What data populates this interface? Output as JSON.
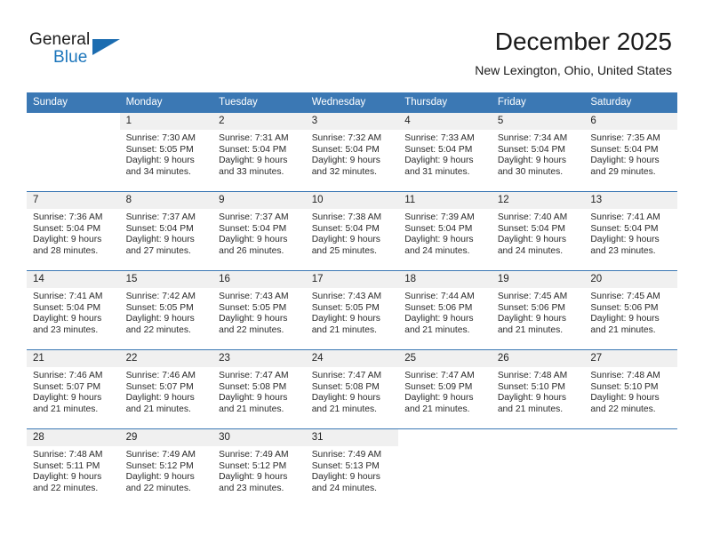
{
  "brand": {
    "word1": "General",
    "word2": "Blue",
    "logo_icon": "blue-triangle-icon",
    "accent_color": "#1b75bb"
  },
  "header": {
    "month_title": "December 2025",
    "location": "New Lexington, Ohio, United States"
  },
  "calendar": {
    "header_bg": "#3b78b4",
    "daynum_bg": "#f0f0f0",
    "weekday_names": [
      "Sunday",
      "Monday",
      "Tuesday",
      "Wednesday",
      "Thursday",
      "Friday",
      "Saturday"
    ],
    "weeks": [
      [
        {
          "day": "",
          "sunrise": "",
          "sunset": "",
          "daylight1": "",
          "daylight2": ""
        },
        {
          "day": "1",
          "sunrise": "Sunrise: 7:30 AM",
          "sunset": "Sunset: 5:05 PM",
          "daylight1": "Daylight: 9 hours",
          "daylight2": "and 34 minutes."
        },
        {
          "day": "2",
          "sunrise": "Sunrise: 7:31 AM",
          "sunset": "Sunset: 5:04 PM",
          "daylight1": "Daylight: 9 hours",
          "daylight2": "and 33 minutes."
        },
        {
          "day": "3",
          "sunrise": "Sunrise: 7:32 AM",
          "sunset": "Sunset: 5:04 PM",
          "daylight1": "Daylight: 9 hours",
          "daylight2": "and 32 minutes."
        },
        {
          "day": "4",
          "sunrise": "Sunrise: 7:33 AM",
          "sunset": "Sunset: 5:04 PM",
          "daylight1": "Daylight: 9 hours",
          "daylight2": "and 31 minutes."
        },
        {
          "day": "5",
          "sunrise": "Sunrise: 7:34 AM",
          "sunset": "Sunset: 5:04 PM",
          "daylight1": "Daylight: 9 hours",
          "daylight2": "and 30 minutes."
        },
        {
          "day": "6",
          "sunrise": "Sunrise: 7:35 AM",
          "sunset": "Sunset: 5:04 PM",
          "daylight1": "Daylight: 9 hours",
          "daylight2": "and 29 minutes."
        }
      ],
      [
        {
          "day": "7",
          "sunrise": "Sunrise: 7:36 AM",
          "sunset": "Sunset: 5:04 PM",
          "daylight1": "Daylight: 9 hours",
          "daylight2": "and 28 minutes."
        },
        {
          "day": "8",
          "sunrise": "Sunrise: 7:37 AM",
          "sunset": "Sunset: 5:04 PM",
          "daylight1": "Daylight: 9 hours",
          "daylight2": "and 27 minutes."
        },
        {
          "day": "9",
          "sunrise": "Sunrise: 7:37 AM",
          "sunset": "Sunset: 5:04 PM",
          "daylight1": "Daylight: 9 hours",
          "daylight2": "and 26 minutes."
        },
        {
          "day": "10",
          "sunrise": "Sunrise: 7:38 AM",
          "sunset": "Sunset: 5:04 PM",
          "daylight1": "Daylight: 9 hours",
          "daylight2": "and 25 minutes."
        },
        {
          "day": "11",
          "sunrise": "Sunrise: 7:39 AM",
          "sunset": "Sunset: 5:04 PM",
          "daylight1": "Daylight: 9 hours",
          "daylight2": "and 24 minutes."
        },
        {
          "day": "12",
          "sunrise": "Sunrise: 7:40 AM",
          "sunset": "Sunset: 5:04 PM",
          "daylight1": "Daylight: 9 hours",
          "daylight2": "and 24 minutes."
        },
        {
          "day": "13",
          "sunrise": "Sunrise: 7:41 AM",
          "sunset": "Sunset: 5:04 PM",
          "daylight1": "Daylight: 9 hours",
          "daylight2": "and 23 minutes."
        }
      ],
      [
        {
          "day": "14",
          "sunrise": "Sunrise: 7:41 AM",
          "sunset": "Sunset: 5:04 PM",
          "daylight1": "Daylight: 9 hours",
          "daylight2": "and 23 minutes."
        },
        {
          "day": "15",
          "sunrise": "Sunrise: 7:42 AM",
          "sunset": "Sunset: 5:05 PM",
          "daylight1": "Daylight: 9 hours",
          "daylight2": "and 22 minutes."
        },
        {
          "day": "16",
          "sunrise": "Sunrise: 7:43 AM",
          "sunset": "Sunset: 5:05 PM",
          "daylight1": "Daylight: 9 hours",
          "daylight2": "and 22 minutes."
        },
        {
          "day": "17",
          "sunrise": "Sunrise: 7:43 AM",
          "sunset": "Sunset: 5:05 PM",
          "daylight1": "Daylight: 9 hours",
          "daylight2": "and 21 minutes."
        },
        {
          "day": "18",
          "sunrise": "Sunrise: 7:44 AM",
          "sunset": "Sunset: 5:06 PM",
          "daylight1": "Daylight: 9 hours",
          "daylight2": "and 21 minutes."
        },
        {
          "day": "19",
          "sunrise": "Sunrise: 7:45 AM",
          "sunset": "Sunset: 5:06 PM",
          "daylight1": "Daylight: 9 hours",
          "daylight2": "and 21 minutes."
        },
        {
          "day": "20",
          "sunrise": "Sunrise: 7:45 AM",
          "sunset": "Sunset: 5:06 PM",
          "daylight1": "Daylight: 9 hours",
          "daylight2": "and 21 minutes."
        }
      ],
      [
        {
          "day": "21",
          "sunrise": "Sunrise: 7:46 AM",
          "sunset": "Sunset: 5:07 PM",
          "daylight1": "Daylight: 9 hours",
          "daylight2": "and 21 minutes."
        },
        {
          "day": "22",
          "sunrise": "Sunrise: 7:46 AM",
          "sunset": "Sunset: 5:07 PM",
          "daylight1": "Daylight: 9 hours",
          "daylight2": "and 21 minutes."
        },
        {
          "day": "23",
          "sunrise": "Sunrise: 7:47 AM",
          "sunset": "Sunset: 5:08 PM",
          "daylight1": "Daylight: 9 hours",
          "daylight2": "and 21 minutes."
        },
        {
          "day": "24",
          "sunrise": "Sunrise: 7:47 AM",
          "sunset": "Sunset: 5:08 PM",
          "daylight1": "Daylight: 9 hours",
          "daylight2": "and 21 minutes."
        },
        {
          "day": "25",
          "sunrise": "Sunrise: 7:47 AM",
          "sunset": "Sunset: 5:09 PM",
          "daylight1": "Daylight: 9 hours",
          "daylight2": "and 21 minutes."
        },
        {
          "day": "26",
          "sunrise": "Sunrise: 7:48 AM",
          "sunset": "Sunset: 5:10 PM",
          "daylight1": "Daylight: 9 hours",
          "daylight2": "and 21 minutes."
        },
        {
          "day": "27",
          "sunrise": "Sunrise: 7:48 AM",
          "sunset": "Sunset: 5:10 PM",
          "daylight1": "Daylight: 9 hours",
          "daylight2": "and 22 minutes."
        }
      ],
      [
        {
          "day": "28",
          "sunrise": "Sunrise: 7:48 AM",
          "sunset": "Sunset: 5:11 PM",
          "daylight1": "Daylight: 9 hours",
          "daylight2": "and 22 minutes."
        },
        {
          "day": "29",
          "sunrise": "Sunrise: 7:49 AM",
          "sunset": "Sunset: 5:12 PM",
          "daylight1": "Daylight: 9 hours",
          "daylight2": "and 22 minutes."
        },
        {
          "day": "30",
          "sunrise": "Sunrise: 7:49 AM",
          "sunset": "Sunset: 5:12 PM",
          "daylight1": "Daylight: 9 hours",
          "daylight2": "and 23 minutes."
        },
        {
          "day": "31",
          "sunrise": "Sunrise: 7:49 AM",
          "sunset": "Sunset: 5:13 PM",
          "daylight1": "Daylight: 9 hours",
          "daylight2": "and 24 minutes."
        },
        {
          "day": "",
          "sunrise": "",
          "sunset": "",
          "daylight1": "",
          "daylight2": ""
        },
        {
          "day": "",
          "sunrise": "",
          "sunset": "",
          "daylight1": "",
          "daylight2": ""
        },
        {
          "day": "",
          "sunrise": "",
          "sunset": "",
          "daylight1": "",
          "daylight2": ""
        }
      ]
    ]
  }
}
